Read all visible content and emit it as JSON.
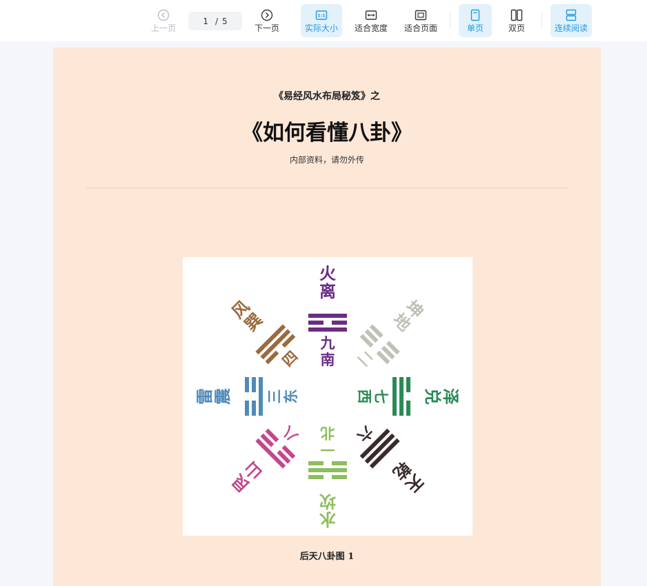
{
  "toolbar": {
    "prev_label": "上一页",
    "next_label": "下一页",
    "current_page": "1",
    "page_separator": "/",
    "total_pages": "5",
    "actual_size_label": "实际大小",
    "fit_width_label": "适合宽度",
    "fit_page_label": "适合页面",
    "single_page_label": "单页",
    "double_page_label": "双页",
    "continuous_label": "连续阅读",
    "actual_size_icon_text": "1:1",
    "active_color": "#1e9be0"
  },
  "document": {
    "subtitle": "《易经风水布局秘笈》之",
    "title": "《如何看懂八卦》",
    "note": "内部资料，请勿外传",
    "figure_caption": "后天八卦图 1",
    "bagua": [
      {
        "name": "火离",
        "number": "九南",
        "color": "#6a2d84"
      },
      {
        "name": "坤地",
        "number": "二",
        "color": "#bfc1b6"
      },
      {
        "name": "泽兑",
        "number": "七西",
        "color": "#2a8a55"
      },
      {
        "name": "天乾",
        "number": "六",
        "color": "#3a2b2b"
      },
      {
        "name": "水坎",
        "number": "一北",
        "color": "#8dbd5c"
      },
      {
        "name": "艮山",
        "number": "八",
        "color": "#c4478e"
      },
      {
        "name": "雷震",
        "number": "三东",
        "color": "#4f8ab8"
      },
      {
        "name": "风巽",
        "number": "四",
        "color": "#9a6b3e"
      }
    ]
  }
}
